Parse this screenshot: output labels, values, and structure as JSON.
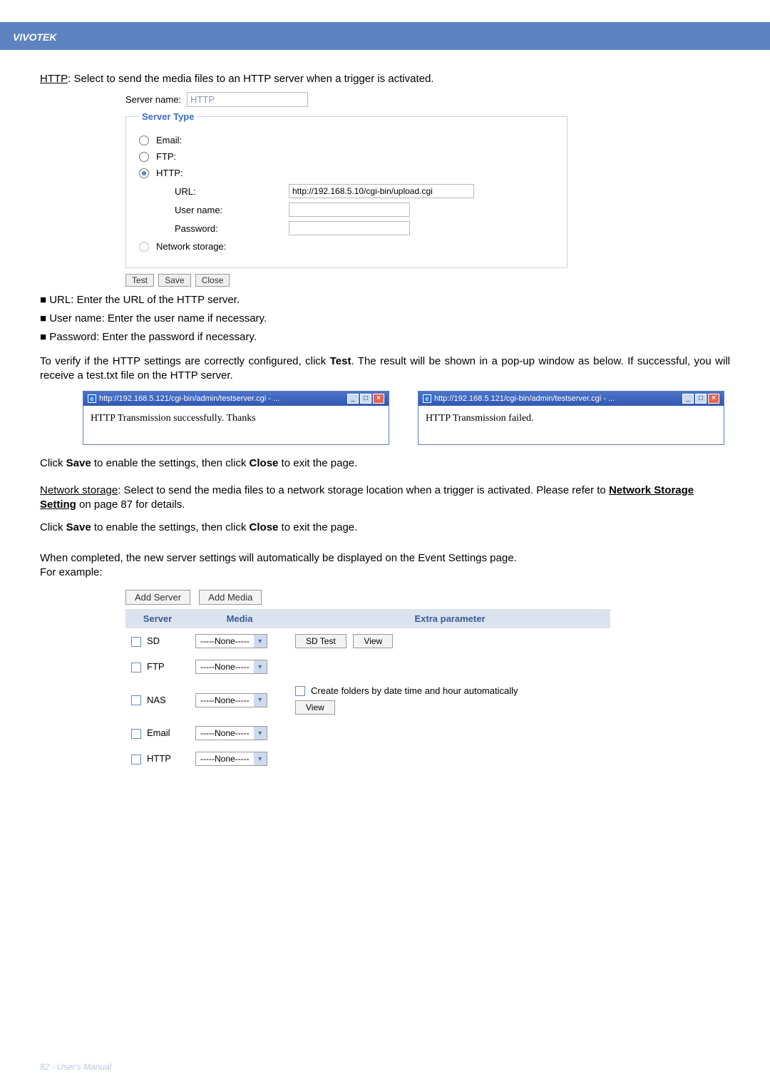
{
  "brand": "VIVOTEK",
  "intro_prefix": "HTTP",
  "intro_text": ": Select to send the media files to an HTTP server when a trigger is activated.",
  "server_name_label": "Server name:",
  "server_name_value": "HTTP",
  "server_type_legend": "Server Type",
  "options": {
    "email": "Email:",
    "ftp": "FTP:",
    "http": "HTTP:",
    "network_storage": "Network storage:"
  },
  "http_fields": {
    "url_label": "URL:",
    "url_value": "http://192.168.5.10/cgi-bin/upload.cgi",
    "user_label": "User name:",
    "pass_label": "Password:"
  },
  "buttons": {
    "test": "Test",
    "save": "Save",
    "close": "Close"
  },
  "bullets": {
    "b1": "■ URL: Enter the URL of the HTTP server.",
    "b2": "■ User name: Enter the user name if necessary.",
    "b3": "■ Password: Enter the password if necessary."
  },
  "verify_text_1": "To verify if the HTTP settings are correctly configured, click ",
  "verify_bold_test": "Test",
  "verify_text_2": ". The result will be shown in a pop-up window as below. If successful, you will receive a test.txt file on the HTTP server.",
  "popup_title": "http://192.168.5.121/cgi-bin/admin/testserver.cgi - ...",
  "popup_success": "HTTP Transmission successfully. Thanks",
  "popup_fail": "HTTP Transmission failed.",
  "save_line_1a": "Click ",
  "save_line_1b": " to enable the settings, then click ",
  "save_line_1c": " to exit the page.",
  "bold_save": "Save",
  "bold_close": "Close",
  "netstorage_prefix": "Network storage",
  "netstorage_text_1": ": Select to send the media files to a network storage location when a trigger is activated. Please refer to ",
  "netstorage_link": "Network Storage Setting",
  "netstorage_text_2": " on page 87 for details.",
  "completed_1": "When completed, the new server settings will automatically be displayed on the Event Settings page.",
  "completed_2": "For example:",
  "event": {
    "add_server": "Add Server",
    "add_media": "Add Media",
    "headers": {
      "server": "Server",
      "media": "Media",
      "extra": "Extra parameter"
    },
    "none": "-----None-----",
    "rows": {
      "sd": "SD",
      "ftp": "FTP",
      "nas": "NAS",
      "email": "Email",
      "http": "HTTP"
    },
    "sd_test": "SD Test",
    "view": "View",
    "create_folders": "Create folders by date time and hour automatically"
  },
  "footer": "82 - User's Manual"
}
